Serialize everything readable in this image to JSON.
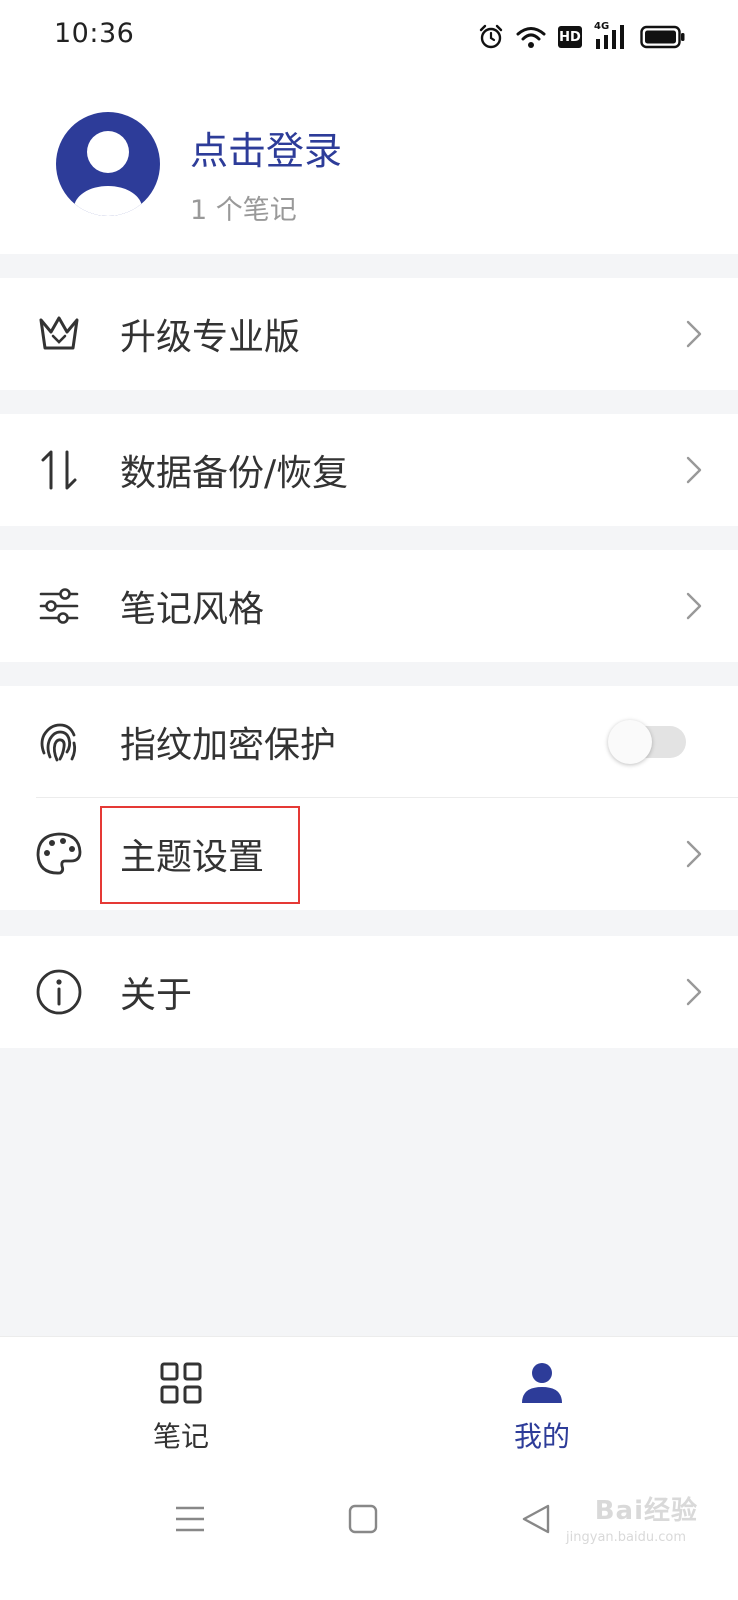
{
  "status_bar": {
    "time": "10:36",
    "icons": [
      "alarm-icon",
      "wifi-icon",
      "hd-icon",
      "signal-4g-icon",
      "battery-icon"
    ],
    "hd_label": "HD",
    "network_label": "4G"
  },
  "profile": {
    "login_label": "点击登录",
    "note_count": "1 个笔记"
  },
  "menu": {
    "upgrade": "升级专业版",
    "backup": "数据备份/恢复",
    "note_style": "笔记风格",
    "fingerprint": "指纹加密保护",
    "fingerprint_enabled": false,
    "theme": "主题设置",
    "about": "关于"
  },
  "bottom_nav": {
    "notes_label": "笔记",
    "mine_label": "我的",
    "active": "我的"
  },
  "watermark": {
    "brand": "Bai经验",
    "url": "jingyan.baidu.com"
  },
  "colors": {
    "accent": "#2d3c99",
    "background": "#f4f5f7",
    "highlight": "#e53935"
  }
}
